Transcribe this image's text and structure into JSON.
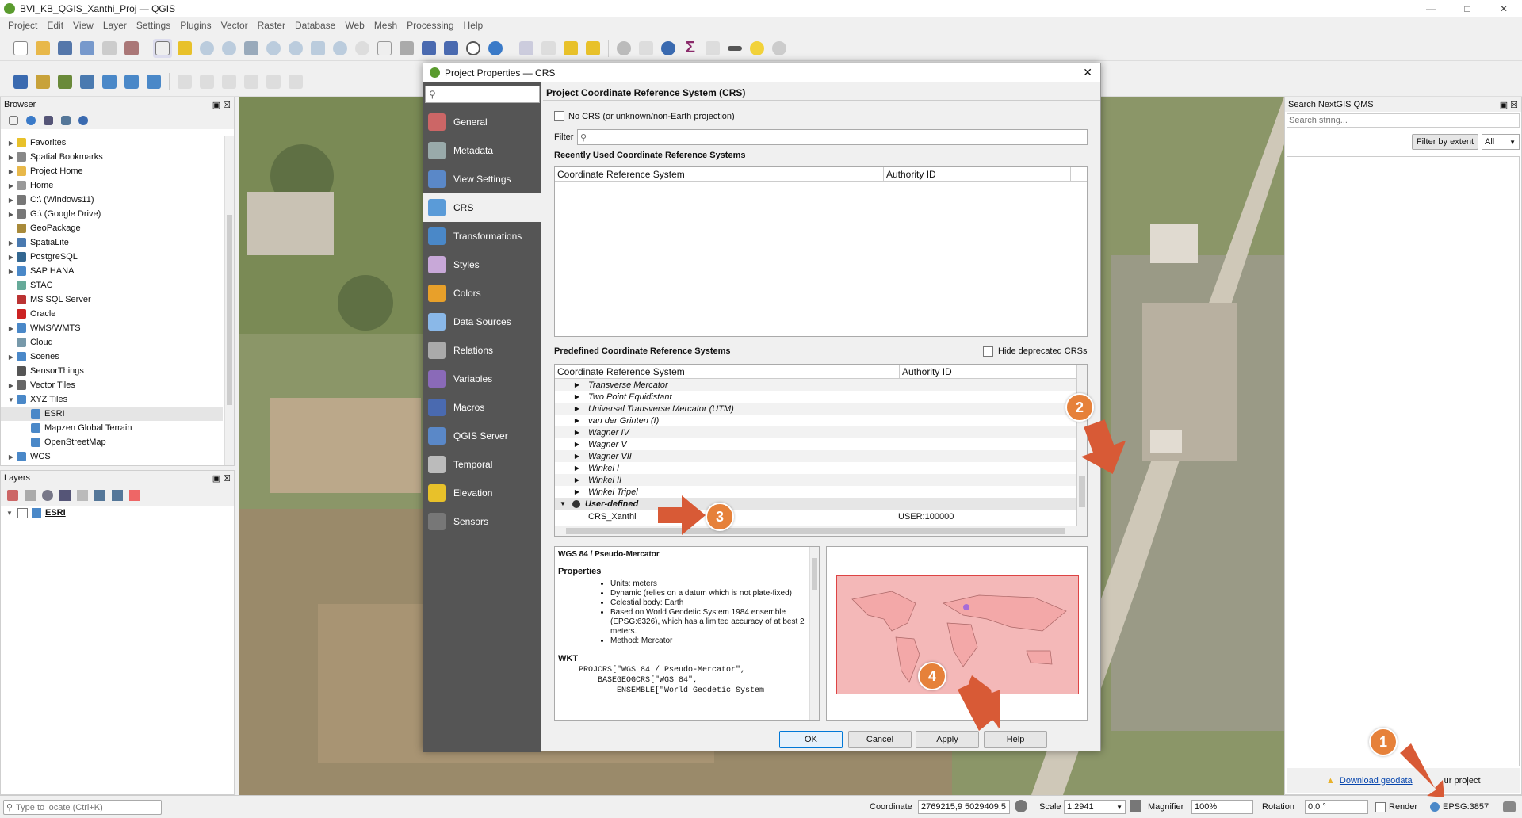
{
  "window": {
    "title": "BVI_KB_QGIS_Xanthi_Proj — QGIS"
  },
  "menu": [
    "Project",
    "Edit",
    "View",
    "Layer",
    "Settings",
    "Plugins",
    "Vector",
    "Raster",
    "Database",
    "Web",
    "Mesh",
    "Processing",
    "Help"
  ],
  "browser": {
    "title": "Browser",
    "items": [
      {
        "label": "Favorites",
        "icon": "star-icon",
        "color": "#e8c12a"
      },
      {
        "label": "Spatial Bookmarks",
        "icon": "bookmark-icon",
        "color": "#888"
      },
      {
        "label": "Project Home",
        "icon": "folder-icon",
        "color": "#e8b84a"
      },
      {
        "label": "Home",
        "icon": "folder-icon",
        "color": "#999"
      },
      {
        "label": "C:\\ (Windows11)",
        "icon": "drive-icon",
        "color": "#777"
      },
      {
        "label": "G:\\ (Google Drive)",
        "icon": "drive-icon",
        "color": "#777"
      },
      {
        "label": "GeoPackage",
        "icon": "geopackage-icon",
        "color": "#a88a3a"
      },
      {
        "label": "SpatiaLite",
        "icon": "spatialite-icon",
        "color": "#4a7ab0"
      },
      {
        "label": "PostgreSQL",
        "icon": "postgresql-icon",
        "color": "#336791"
      },
      {
        "label": "SAP HANA",
        "icon": "database-icon",
        "color": "#4a88c8"
      },
      {
        "label": "STAC",
        "icon": "stac-icon",
        "color": "#6a9"
      },
      {
        "label": "MS SQL Server",
        "icon": "database-icon",
        "color": "#b33"
      },
      {
        "label": "Oracle",
        "icon": "database-icon",
        "color": "#c22"
      },
      {
        "label": "WMS/WMTS",
        "icon": "globe-icon",
        "color": "#4a88c8"
      },
      {
        "label": "Cloud",
        "icon": "cloud-icon",
        "color": "#79a"
      },
      {
        "label": "Scenes",
        "icon": "scenes-icon",
        "color": "#4a88c8"
      },
      {
        "label": "SensorThings",
        "icon": "sensor-icon",
        "color": "#555"
      },
      {
        "label": "Vector Tiles",
        "icon": "grid-icon",
        "color": "#666"
      },
      {
        "label": "XYZ Tiles",
        "icon": "grid-icon",
        "color": "#4a88c8"
      },
      {
        "label": "ESRI",
        "icon": "grid-icon",
        "color": "#4a88c8"
      },
      {
        "label": "Mapzen Global Terrain",
        "icon": "grid-icon",
        "color": "#4a88c8"
      },
      {
        "label": "OpenStreetMap",
        "icon": "grid-icon",
        "color": "#4a88c8"
      },
      {
        "label": "WCS",
        "icon": "globe-icon",
        "color": "#4a88c8"
      }
    ]
  },
  "layers": {
    "title": "Layers",
    "items": [
      {
        "label": "ESRI"
      }
    ]
  },
  "dialog": {
    "title": "Project Properties — CRS",
    "nav": [
      "General",
      "Metadata",
      "View Settings",
      "CRS",
      "Transformations",
      "Styles",
      "Colors",
      "Data Sources",
      "Relations",
      "Variables",
      "Macros",
      "QGIS Server",
      "Temporal",
      "Elevation",
      "Sensors"
    ],
    "section_title": "Project Coordinate Reference System (CRS)",
    "no_crs": "No CRS (or unknown/non-Earth projection)",
    "filter_label": "Filter",
    "recent_title": "Recently Used Coordinate Reference Systems",
    "col_crs": "Coordinate Reference System",
    "col_auth": "Authority ID",
    "predef_title": "Predefined Coordinate Reference Systems",
    "hide_deprecated": "Hide deprecated CRSs",
    "crs_list": [
      "Transverse Mercator",
      "Two Point Equidistant",
      "Universal Transverse Mercator (UTM)",
      "van der Grinten (I)",
      "Wagner IV",
      "Wagner V",
      "Wagner VII",
      "Winkel I",
      "Winkel II",
      "Winkel Tripel"
    ],
    "user_defined": "User-defined",
    "custom_crs": {
      "name": "CRS_Xanthi",
      "auth": "USER:100000"
    },
    "info": {
      "name": "WGS 84 / Pseudo-Mercator",
      "props_title": "Properties",
      "props": [
        "Units: meters",
        "Dynamic (relies on a datum which is not plate-fixed)",
        "Celestial body: Earth",
        "Based on World Geodetic System 1984 ensemble (EPSG:6326), which has a limited accuracy of at best 2 meters.",
        "Method: Mercator"
      ],
      "wkt_title": "WKT",
      "wkt": [
        "PROJCRS[\"WGS 84 / Pseudo-Mercator\",",
        "    BASEGEOGCRS[\"WGS 84\",",
        "        ENSEMBLE[\"World Geodetic System"
      ]
    },
    "buttons": {
      "ok": "OK",
      "cancel": "Cancel",
      "apply": "Apply",
      "help": "Help"
    }
  },
  "qms": {
    "title": "Search NextGIS QMS",
    "placeholder": "Search string...",
    "filter_btn": "Filter by extent",
    "filter_opt": "All",
    "footer_link": "Download geodata",
    "footer_text": "ur project"
  },
  "status": {
    "locate_placeholder": "Type to locate (Ctrl+K)",
    "coord_label": "Coordinate",
    "coord": "2769215,9  5029409,5",
    "scale_label": "Scale",
    "scale": "1:2941",
    "mag_label": "Magnifier",
    "mag": "100%",
    "rot_label": "Rotation",
    "rot": "0,0 °",
    "render": "Render",
    "epsg": "EPSG:3857"
  },
  "callouts": [
    "1",
    "2",
    "3",
    "4"
  ],
  "colors": {
    "accent": "#e6813a",
    "arrow": "#d85a36",
    "nav_bg": "#555555"
  }
}
